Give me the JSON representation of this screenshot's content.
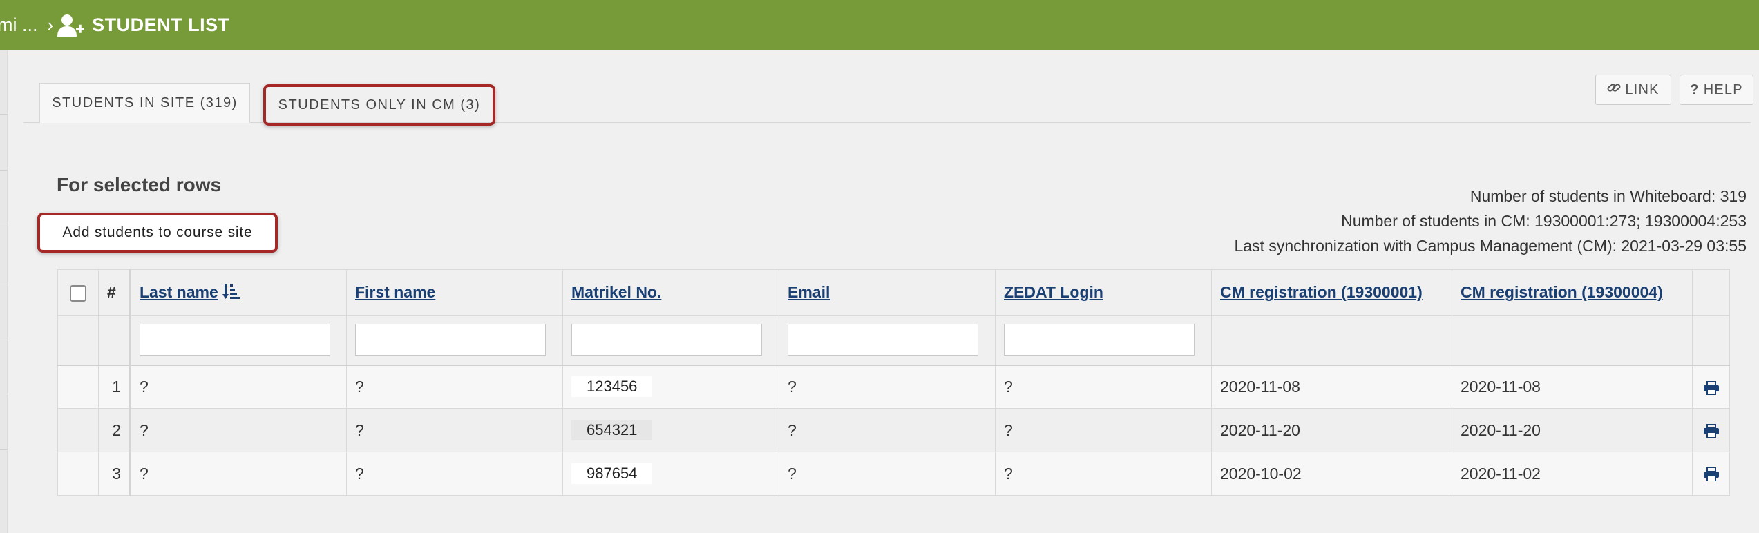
{
  "header": {
    "breadcrumb_prev": "mi ...",
    "breadcrumb_sep": "›",
    "title": "STUDENT LIST",
    "icon": "user-plus-icon"
  },
  "tabs": [
    {
      "label": "STUDENTS IN SITE (319)",
      "active": true
    },
    {
      "label": "STUDENTS ONLY IN CM (3)",
      "active": false
    }
  ],
  "toolbar": {
    "link_label": "LINK",
    "help_label": "HELP"
  },
  "selected_rows": {
    "title": "For selected rows",
    "add_button": "Add students to course site"
  },
  "stats": {
    "whiteboard": "Number of students in Whiteboard: 319",
    "cm": "Number of students in CM: 19300001:273; 19300004:253",
    "last_sync": "Last synchronization with Campus Management (CM): 2021-03-29 03:55"
  },
  "table": {
    "columns": {
      "num": "#",
      "last_name": "Last name",
      "first_name": "First name",
      "matrikel": "Matrikel No.",
      "email": "Email",
      "zedat": "ZEDAT Login",
      "cm1": "CM registration (19300001)",
      "cm2": "CM registration (19300004)"
    },
    "rows": [
      {
        "num": "1",
        "last_name": "?",
        "first_name": "?",
        "matrikel": "123456",
        "email": "?",
        "zedat": "?",
        "cm1": "2020-11-08",
        "cm2": "2020-11-08"
      },
      {
        "num": "2",
        "last_name": "?",
        "first_name": "?",
        "matrikel": "654321",
        "email": "?",
        "zedat": "?",
        "cm1": "2020-11-20",
        "cm2": "2020-11-20"
      },
      {
        "num": "3",
        "last_name": "?",
        "first_name": "?",
        "matrikel": "987654",
        "email": "?",
        "zedat": "?",
        "cm1": "2020-10-02",
        "cm2": "2020-11-02"
      }
    ]
  },
  "colors": {
    "topbar": "#769b38",
    "link": "#1a3f73",
    "highlight": "#a52826"
  }
}
